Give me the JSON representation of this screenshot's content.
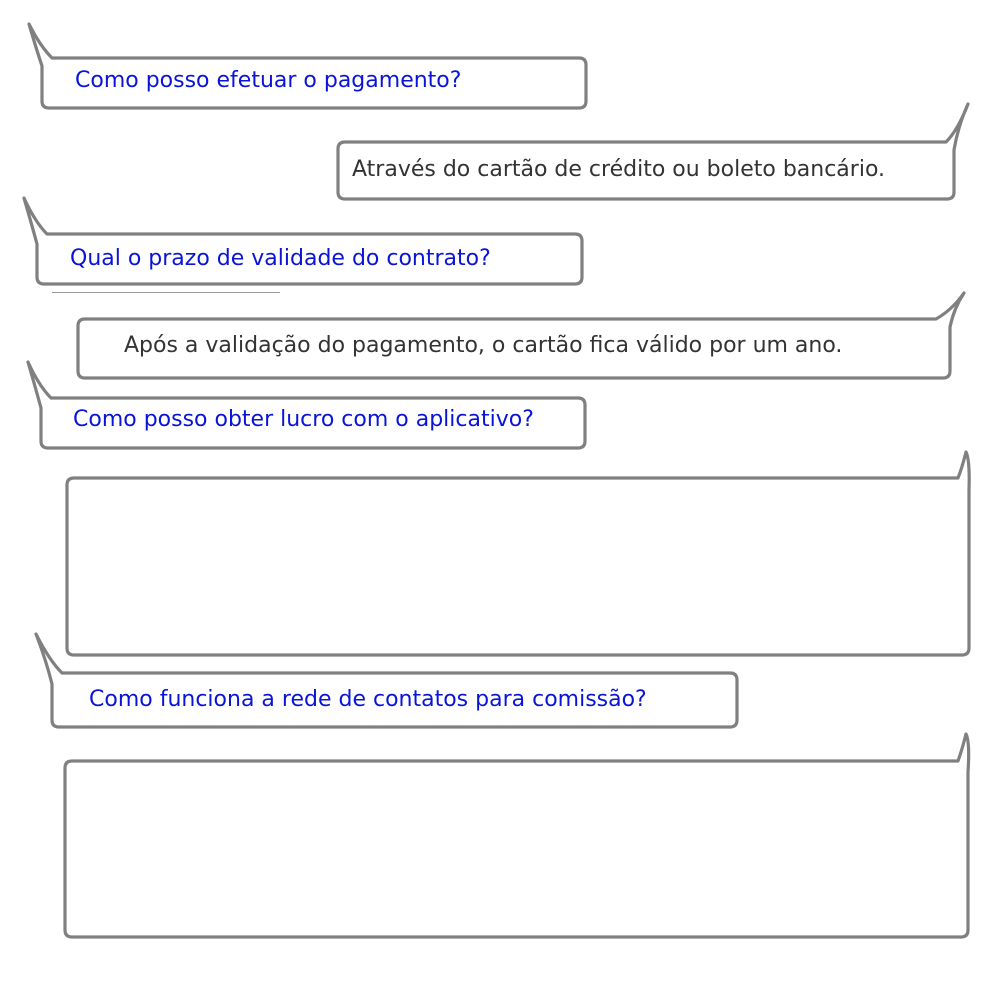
{
  "conversation": {
    "messages": [
      {
        "role": "question",
        "side": "left",
        "text": "Como posso efetuar o pagamento?"
      },
      {
        "role": "answer",
        "side": "right",
        "text": "Através do cartão de crédito ou boleto bancário."
      },
      {
        "role": "question",
        "side": "left",
        "text": "Qual o prazo de validade do contrato?"
      },
      {
        "role": "answer",
        "side": "right",
        "text": "Após a validação do pagamento, o cartão fica válido por um ano."
      },
      {
        "role": "question",
        "side": "left",
        "text": "Como posso obter lucro com o aplicativo?"
      },
      {
        "role": "answer",
        "side": "right",
        "text": ""
      },
      {
        "role": "question",
        "side": "left",
        "text": "Como funciona a rede de contatos para comissão?"
      },
      {
        "role": "answer",
        "side": "right",
        "text": ""
      }
    ]
  },
  "colors": {
    "question_text": "#0a14d8",
    "answer_text": "#333333",
    "bubble_border": "#808080",
    "bubble_fill": "#ffffff"
  }
}
